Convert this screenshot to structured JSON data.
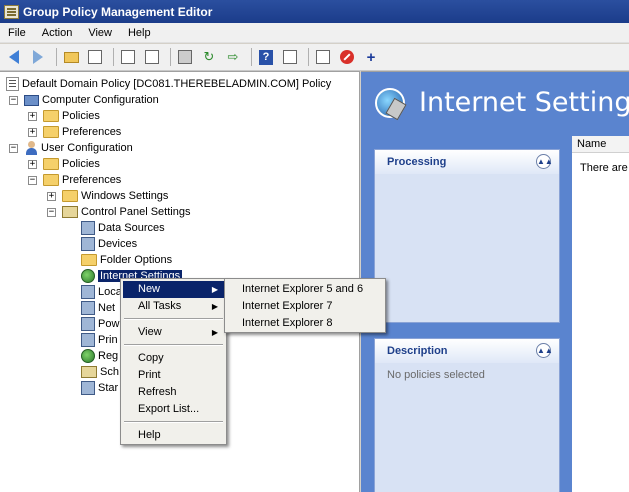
{
  "window": {
    "title": "Group Policy Management Editor"
  },
  "menubar": {
    "items": [
      "File",
      "Action",
      "View",
      "Help"
    ]
  },
  "toolbar": {
    "buttons": [
      "back-icon",
      "forward-icon",
      "up-folder-icon",
      "show-hide-tree-icon",
      "copy-icon",
      "paste-icon",
      "print-icon",
      "refresh-icon",
      "export-list-icon",
      "help-icon",
      "properties-icon",
      "filter-icon",
      "stop-icon",
      "add-icon"
    ]
  },
  "tree": {
    "root": "Default Domain Policy [DC081.THEREBELADMIN.COM] Policy",
    "computer_config": "Computer Configuration",
    "cc_policies": "Policies",
    "cc_preferences": "Preferences",
    "user_config": "User Configuration",
    "uc_policies": "Policies",
    "uc_preferences": "Preferences",
    "windows_settings": "Windows Settings",
    "control_panel_settings": "Control Panel Settings",
    "data_sources": "Data Sources",
    "devices": "Devices",
    "folder_options": "Folder Options",
    "internet_settings": "Internet Settings",
    "loc": "Loca",
    "net": "Net",
    "pow": "Pow",
    "prin": "Prin",
    "reg": "Reg",
    "sch": "Sch",
    "star": "Star"
  },
  "right_pane": {
    "title": "Internet Settings",
    "processing": {
      "title": "Processing"
    },
    "description": {
      "title": "Description",
      "text": "No policies selected"
    },
    "list": {
      "column_name": "Name",
      "empty_text": "There are"
    }
  },
  "context_menu": {
    "new": "New",
    "all_tasks": "All Tasks",
    "view": "View",
    "copy": "Copy",
    "print": "Print",
    "refresh": "Refresh",
    "export_list": "Export List...",
    "help": "Help",
    "submenu_arrow": "▶"
  },
  "submenu": {
    "ie56": "Internet Explorer 5 and 6",
    "ie7": "Internet Explorer 7",
    "ie8": "Internet Explorer 8"
  },
  "tree_expanders": {
    "plus": "+",
    "minus": "−"
  },
  "colors": {
    "selection": "#0a246a",
    "right_pane_bg": "#5a84cf",
    "title_bar": "#1b3c8a"
  }
}
